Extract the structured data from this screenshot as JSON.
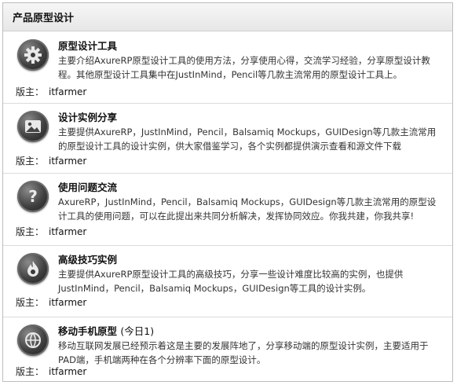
{
  "header": {
    "title": "产品原型设计"
  },
  "moderator_label": "版主：",
  "forums": [
    {
      "icon": "gear-icon",
      "title": "原型设计工具",
      "note": "",
      "description": "主要介绍AxureRP原型设计工具的使用方法，分享使用心得，交流学习经验，分享原型设计教程。其他原型设计工具集中在JustInMind，Pencil等几款主流常用的原型设计工具上。",
      "moderator": "itfarmer"
    },
    {
      "icon": "picture-icon",
      "title": "设计实例分享",
      "note": "",
      "description": "主要提供AxureRP，JustInMind，Pencil，Balsamiq Mockups，GUIDesign等几款主流常用的原型设计工具的设计实例，供大家借鉴学习，各个实例都提供演示查看和源文件下载",
      "moderator": "itfarmer"
    },
    {
      "icon": "question-icon",
      "title": "使用问题交流",
      "note": "",
      "description": "AxureRP，JustInMind，Pencil，Balsamiq Mockups，GUIDesign等几款主流常用的原型设计工具的使用问题，可以在此提出来共同分析解决，发挥协同效应。你我共建，你我共享!",
      "moderator": "itfarmer"
    },
    {
      "icon": "flame-icon",
      "title": "高级技巧实例",
      "note": "",
      "description": "主要提供AxureRP原型设计工具的高级技巧，分享一些设计难度比较高的实例，也提供JustInMind，Pencil，Balsamiq Mockups，GUIDesign等工具的设计实例。",
      "moderator": "itfarmer"
    },
    {
      "icon": "mobile-globe-icon",
      "title": "移动手机原型",
      "note": "(今日1)",
      "description": "移动互联网发展已经预示着这是主要的发展阵地了，分享移动端的原型设计实例，主要适用于PAD端，手机端两种在各个分辨率下面的原型设计。",
      "moderator": "itfarmer"
    }
  ]
}
